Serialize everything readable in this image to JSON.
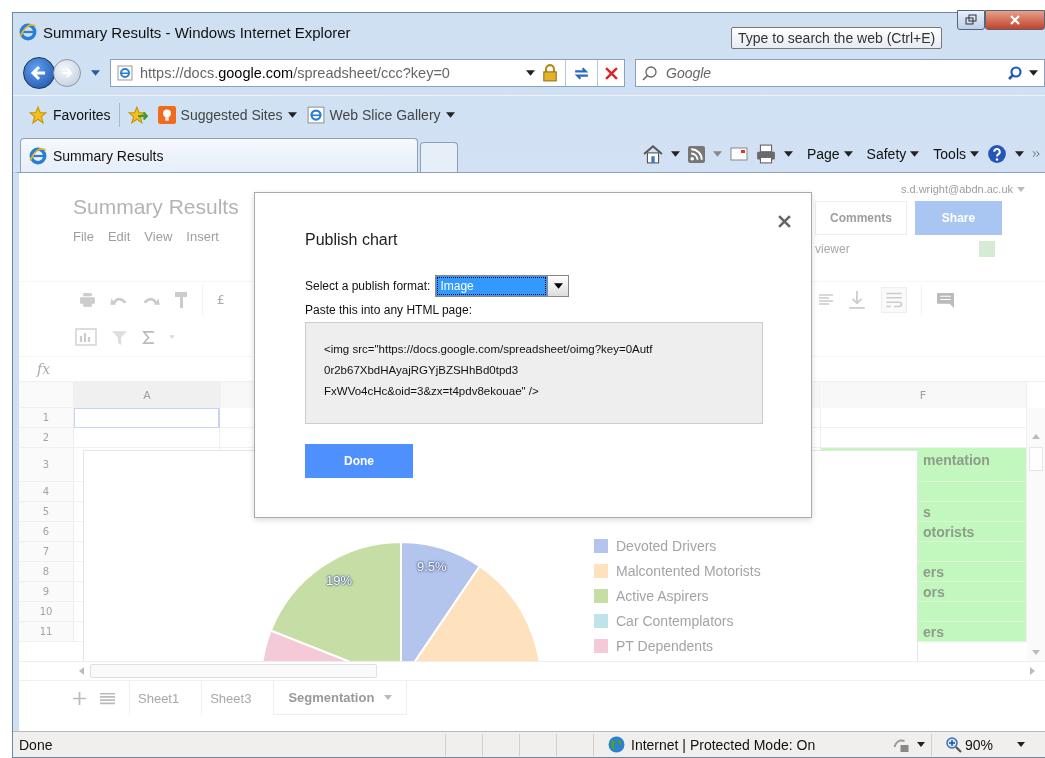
{
  "window": {
    "title": "Summary Results - Windows Internet Explorer"
  },
  "tooltip": "Type to search the web (Ctrl+E)",
  "address_bar": {
    "url": "https://docs.**google.com**/spreadsheet/ccc?key=0"
  },
  "search": {
    "placeholder": "Google"
  },
  "favorites_bar": {
    "favorites": "Favorites",
    "items": [
      {
        "label": "Suggested Sites",
        "kind": "suggested"
      },
      {
        "label": "Web Slice Gallery",
        "kind": "ie"
      }
    ]
  },
  "tabs": [
    {
      "label": "Summary Results",
      "selected": true
    }
  ],
  "command_bar": [
    "Page",
    "Safety",
    "Tools"
  ],
  "spreadsheet": {
    "title": "Summary Results",
    "menu": [
      "File",
      "Edit",
      "View",
      "Insert"
    ],
    "account": "s.d.wright@abdn.ac.uk",
    "comments": "Comments",
    "share": "Share",
    "access": "viewer",
    "currency": "£",
    "formula_label": "fx",
    "columns": [
      "A",
      "F"
    ],
    "rows": [
      {
        "number": "1",
        "highlighted": false,
        "a_selected": true
      },
      {
        "number": "2",
        "highlighted": false,
        "a_selected": false
      },
      {
        "number": "3",
        "highlighted": true,
        "a_selected": false,
        "column_f": "mentation"
      },
      {
        "number": "4",
        "highlighted": true,
        "a_selected": false
      },
      {
        "number": "5",
        "highlighted": true,
        "a_selected": false,
        "column_f": "s"
      },
      {
        "number": "6",
        "highlighted": true,
        "a_selected": false,
        "column_f": "otorists"
      },
      {
        "number": "7",
        "highlighted": true,
        "a_selected": false
      },
      {
        "number": "8",
        "highlighted": true,
        "a_selected": false,
        "column_f": "ers"
      },
      {
        "number": "9",
        "highlighted": true,
        "a_selected": false,
        "column_f": "ors"
      },
      {
        "number": "10",
        "highlighted": true,
        "a_selected": false
      },
      {
        "number": "11",
        "highlighted": true,
        "a_selected": false,
        "column_f": "ers"
      }
    ],
    "sheets": [
      {
        "label": "Sheet1",
        "selected": false
      },
      {
        "label": "Sheet3",
        "selected": false
      },
      {
        "label": "Segmentation",
        "selected": true
      }
    ],
    "chart": {
      "slice_labels": [
        "9.5%",
        "19%"
      ],
      "legend": [
        {
          "label": "Devoted Drivers",
          "color": "#b3c5ec"
        },
        {
          "label": "Malcontented Motorists",
          "color": "#fde2bd"
        },
        {
          "label": "Active Aspirers",
          "color": "#c6dea6"
        },
        {
          "label": "Car Contemplators",
          "color": "#bfe3ea"
        },
        {
          "label": "PT Dependents",
          "color": "#f5cad8"
        }
      ]
    }
  },
  "dialog": {
    "title": "Publish chart",
    "format_label": "Select a publish format:",
    "format": "Image",
    "paste_label": "Paste this into any HTML page:",
    "code_lines": [
      "<img src=\"https://docs.google.com/spreadsheet/oimg?key=0Autf",
      "0r2b67XbdHAyajRGYjBZSHhBd0tpd3",
      "FxWVo4cHc&oid=3&zx=t4pdv8ekouae\" />"
    ],
    "done": "Done"
  },
  "status_bar": {
    "text": "Done",
    "zone": "Internet | Protected Mode: On",
    "zoom": "90%"
  }
}
